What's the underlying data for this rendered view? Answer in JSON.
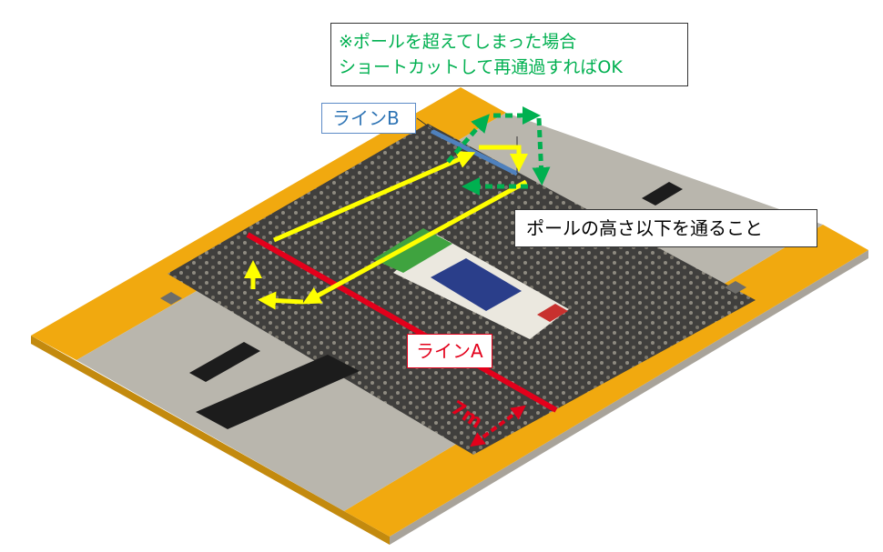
{
  "annotations": {
    "note_line1": "※ポールを超えてしまった場合",
    "note_line2": "ショートカットして再通過すればOK",
    "line_b": "ラインB",
    "line_a": "ラインA",
    "pole_note": "ポールの高さ以下を通ること",
    "distance": "7m"
  },
  "colors": {
    "border_orange": "#f1a90f",
    "floor_gray": "#b9b6ad",
    "field_dark": "#403f3d",
    "line_a": "#e3001b",
    "line_b": "#4f81bd",
    "path_yellow": "#ffff00",
    "shortcut_green": "#00b050",
    "pad_green": "#3fa33f",
    "pad_blue": "#2a3e8a",
    "pad_red": "#c8312e",
    "pad_cream": "#ebe8df"
  },
  "icons": [
    "right-arrow-icon",
    "up-arrow-icon",
    "left-arrow-icon",
    "down-arrow-icon"
  ]
}
